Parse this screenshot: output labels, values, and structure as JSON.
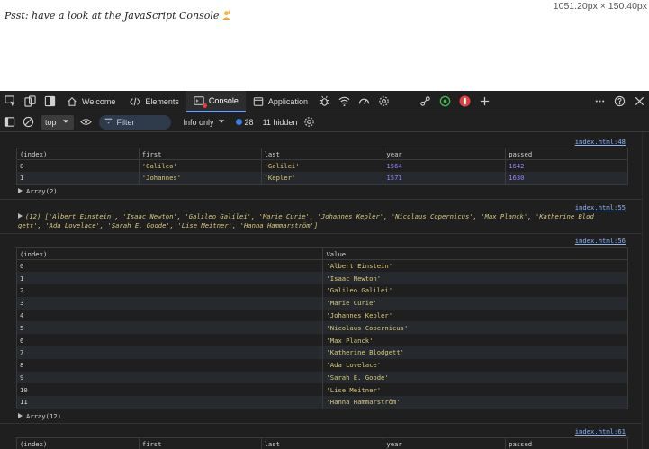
{
  "page": {
    "text": "Psst: have a look at the JavaScript Console",
    "dimensions": "1051.20px × 150.40px"
  },
  "tabs": [
    {
      "label": "Welcome",
      "icon": "home-icon"
    },
    {
      "label": "Elements",
      "icon": "code-icon"
    },
    {
      "label": "Console",
      "icon": "console-icon"
    },
    {
      "label": "Application",
      "icon": "application-icon"
    }
  ],
  "toolbar": {
    "context": "top",
    "filter_placeholder": "Filter",
    "levels": "Info only",
    "issues_count": "28",
    "hidden": "11 hidden"
  },
  "messages": {
    "m1": {
      "source": "index.html:48",
      "columns": [
        "(index)",
        "first",
        "last",
        "year",
        "passed"
      ],
      "rows": [
        [
          "0",
          "'Galileo'",
          "'Galilei'",
          "1564",
          "1642"
        ],
        [
          "1",
          "'Johannes'",
          "'Kepler'",
          "1571",
          "1630"
        ]
      ],
      "summary": "Array(2)"
    },
    "m2": {
      "source": "index.html:55",
      "prefix": "(12) [",
      "items": [
        "'Albert Einstein'",
        "'Isaac Newton'",
        "'Galileo Galilei'",
        "'Marie Curie'",
        "'Johannes Kepler'",
        "'Nicolaus Copernicus'",
        "'Max Planck'",
        "'Katherine Blodgett'",
        "'Ada Lovelace'",
        "'Sarah E. Goode'",
        "'Lise Meitner'",
        "'Hanna Hammarström'"
      ],
      "line1": "(12) ['Albert Einstein', 'Isaac Newton', 'Galileo Galilei', 'Marie Curie', 'Johannes Kepler', 'Nicolaus Copernicus', 'Max Planck', 'Katherine Blod",
      "line2": "gett', 'Ada Lovelace', 'Sarah E. Goode', 'Lise Meitner', 'Hanna Hammarström']"
    },
    "m3": {
      "source": "index.html:56",
      "columns": [
        "(index)",
        "Value"
      ],
      "rows": [
        [
          "0",
          "'Albert Einstein'"
        ],
        [
          "1",
          "'Isaac Newton'"
        ],
        [
          "2",
          "'Galileo Galilei'"
        ],
        [
          "3",
          "'Marie Curie'"
        ],
        [
          "4",
          "'Johannes Kepler'"
        ],
        [
          "5",
          "'Nicolaus Copernicus'"
        ],
        [
          "6",
          "'Max Planck'"
        ],
        [
          "7",
          "'Katherine Blodgett'"
        ],
        [
          "8",
          "'Ada Lovelace'"
        ],
        [
          "9",
          "'Sarah E. Goode'"
        ],
        [
          "10",
          "'Lise Meitner'"
        ],
        [
          "11",
          "'Hanna Hammarström'"
        ]
      ],
      "summary": "Array(12)"
    },
    "m4": {
      "source": "index.html:61",
      "columns": [
        "(index)",
        "first",
        "last",
        "year",
        "passed"
      ]
    }
  },
  "colors": {
    "devtools_bg": "#1f1f1f",
    "string": "#d9c97b",
    "number": "#9980ff",
    "link": "#8ab4f8",
    "active_tab_underline": "#6aa0f8"
  }
}
